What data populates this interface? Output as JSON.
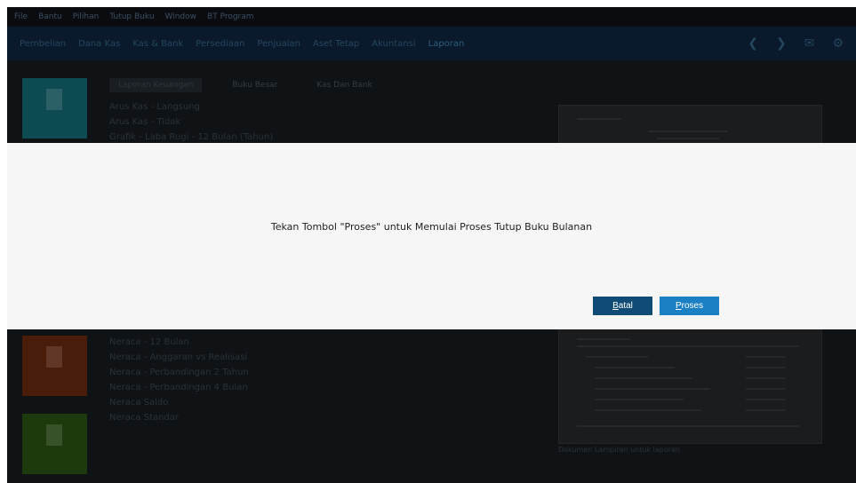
{
  "menubar": {
    "items": [
      "File",
      "Bantu",
      "Pilihan",
      "Tutup Buku",
      "Window",
      "BT Program"
    ]
  },
  "navbar": {
    "items": [
      "Pembelian",
      "Dana Kas",
      "Kas & Bank",
      "Persediaan",
      "Penjualan",
      "Aset Tetap",
      "Akuntansi",
      "Laporan"
    ],
    "active_index": 7,
    "right_icons": [
      "back-icon",
      "forward-icon",
      "mail-icon",
      "gear-icon"
    ]
  },
  "background": {
    "tabs": [
      "Laporan Keuangan",
      "Buku Besar",
      "Kas Dan Bank"
    ],
    "active_tab": 0,
    "report_list_top": [
      "Arus Kas - Langsung",
      "Arus Kas - Tidak",
      "Grafik - Laba Rugi - 12 Bulan (Tahun)"
    ],
    "report_list_bottom": [
      "Neraca - 12 Bulan",
      "Neraca - Anggaran vs Realisasi",
      "Neraca - Perbandingan 2 Tahun",
      "Neraca - Perbandingan 4 Bulan",
      "Neraca Saldo",
      "Neraca Standar"
    ],
    "preview_caption": "Dokumen Lampiran untuk laporan",
    "tile_colors": [
      "#0e4a52",
      "#4a1c0a",
      "#1d3a0c"
    ]
  },
  "dialog": {
    "message": "Tekan Tombol \"Proses\" untuk Memulai Proses Tutup Buku Bulanan",
    "cancel_label_first": "B",
    "cancel_label_rest": "atal",
    "process_label_first": "P",
    "process_label_rest": "roses",
    "cancel_color": "#0f4b74",
    "process_color": "#1b7fc3"
  }
}
